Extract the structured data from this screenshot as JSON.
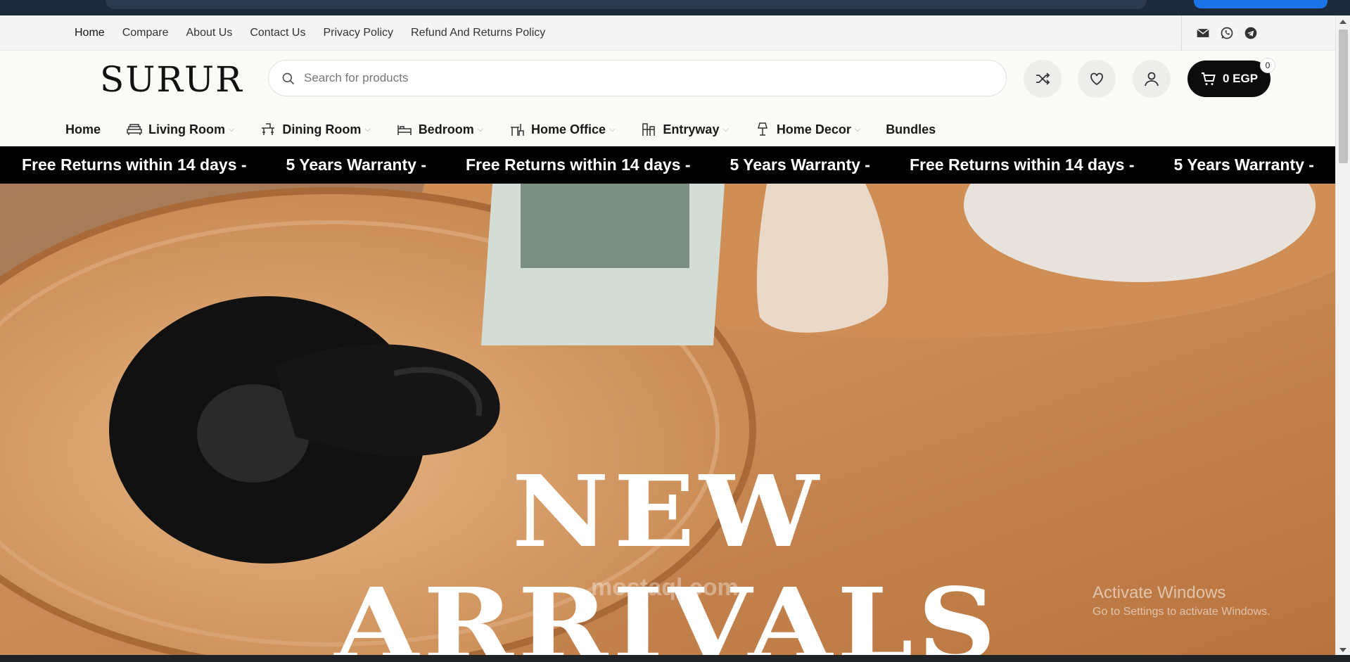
{
  "util_nav": {
    "links": [
      "Home",
      "Compare",
      "About Us",
      "Contact Us",
      "Privacy Policy",
      "Refund And Returns Policy"
    ],
    "social": [
      "mail-icon",
      "whatsapp-icon",
      "telegram-icon"
    ]
  },
  "header": {
    "logo": "SURUR",
    "search_placeholder": "Search for products",
    "cart_label": "0 EGP",
    "cart_count": "0"
  },
  "main_nav": {
    "items": [
      {
        "label": "Home",
        "icon": "",
        "dropdown": false
      },
      {
        "label": "Living Room",
        "icon": "sofa-icon",
        "dropdown": true
      },
      {
        "label": "Dining Room",
        "icon": "dining-table-icon",
        "dropdown": true
      },
      {
        "label": "Bedroom",
        "icon": "bed-icon",
        "dropdown": true
      },
      {
        "label": "Home Office",
        "icon": "desk-chair-icon",
        "dropdown": true
      },
      {
        "label": "Entryway",
        "icon": "bench-icon",
        "dropdown": true
      },
      {
        "label": "Home Decor",
        "icon": "lamp-icon",
        "dropdown": true
      },
      {
        "label": "Bundles",
        "icon": "",
        "dropdown": false
      }
    ]
  },
  "marquee": {
    "items": [
      "Free Returns within 14 days -",
      "5 Years Warranty -",
      "Free Returns within 14 days -",
      "5 Years Warranty -",
      "Free Returns within 14 days -",
      "5 Years Warranty -"
    ]
  },
  "hero": {
    "line1": "NEW",
    "line2": "ARRIVALS",
    "watermark": "mostaql.com",
    "activate_title": "Activate Windows",
    "activate_sub": "Go to Settings to activate Windows."
  },
  "colors": {
    "marquee_bg": "#000000",
    "cart_bg": "#0c0c0c",
    "hero_wood": "#c4814d"
  }
}
